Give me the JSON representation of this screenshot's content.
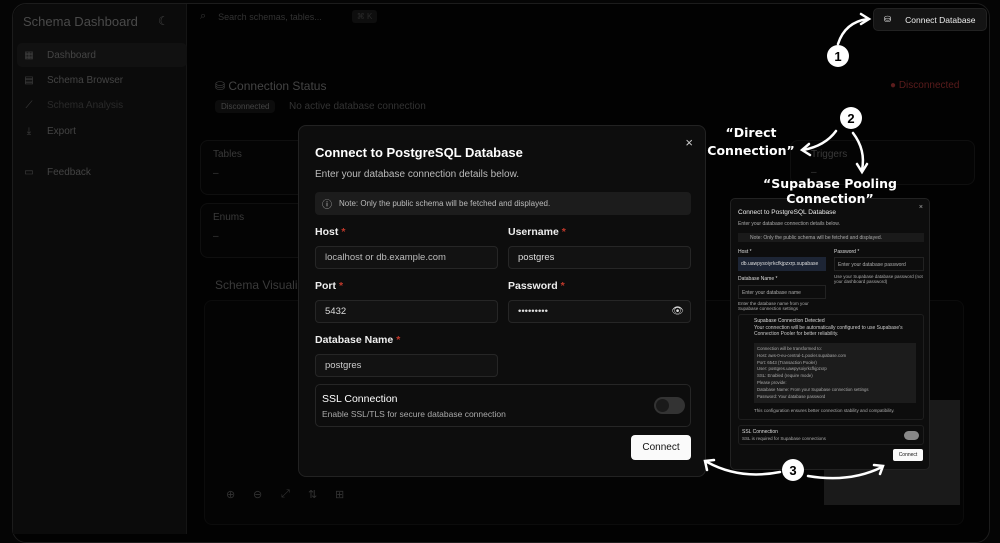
{
  "sidebar": {
    "title": "Schema Dashboard",
    "items": [
      {
        "label": "Dashboard",
        "icon": "grid-icon"
      },
      {
        "label": "Schema Browser",
        "icon": "file-icon"
      },
      {
        "label": "Schema Analysis",
        "icon": "chart-icon"
      },
      {
        "label": "Export",
        "icon": "download-icon"
      },
      {
        "label": "Feedback",
        "icon": "message-icon"
      }
    ]
  },
  "header": {
    "search_placeholder": "Search schemas, tables...",
    "shortcut": "⌘ K",
    "connect_label": "Connect Database"
  },
  "status": {
    "title": "Connection Status",
    "badge": "Disconnected",
    "message": "No active database connection",
    "indicator": "Disconnected",
    "indicator_color": "#7a1f1f"
  },
  "cards": {
    "tables": "Tables",
    "tables_value": "–",
    "enums": "Enums",
    "enums_value": "–",
    "triggers": "Triggers",
    "triggers_value": "–",
    "schema_vis": "Schema Visualization"
  },
  "modal": {
    "title": "Connect to PostgreSQL Database",
    "subtitle": "Enter your database connection details below.",
    "note": "Note: Only the public schema will be fetched and displayed.",
    "host_label": "Host",
    "host_placeholder": "localhost or db.example.com",
    "username_label": "Username",
    "username_value": "postgres",
    "port_label": "Port",
    "port_value": "5432",
    "password_label": "Password",
    "password_value": "•••••••••",
    "dbname_label": "Database Name",
    "dbname_value": "postgres",
    "ssl_title": "SSL Connection",
    "ssl_desc": "Enable SSL/TLS for secure database connection",
    "ssl_enabled": false,
    "connect_label": "Connect",
    "close": "×"
  },
  "inset": {
    "title": "Connect to PostgreSQL Database",
    "subtitle": "Enter your database connection details below.",
    "note": "Note: Only the public schema will be fetched and displayed.",
    "host_label": "Host *",
    "host_value": "db.uawpysoiyrkcfkjpzxrp.supabase",
    "password_label": "Password *",
    "password_placeholder": "Enter your database password",
    "password_hint": "Use your Supabase database password (not your dashboard password)",
    "dbname_label": "Database Name *",
    "dbname_placeholder": "Enter your database name",
    "dbname_hint": "Enter the database name from your Supabase connection settings",
    "detected_title": "Supabase Connection Detected",
    "detected_desc": "Your connection will be automatically configured to use Supabase's Connection Pooler for better reliability.",
    "transform_title": "Connection will be transformed to:",
    "transform": [
      "Host: aws-0-eu-central-1.pooler.supabase.com",
      "Port: 6543 (Transaction Pooler)",
      "User: postgres.uawpysoiyrkcfkjpzxrp",
      "SSL: Enabled (require mode)"
    ],
    "provide_title": "Please provide:",
    "provide": [
      "Database Name: From your Supabase connection settings",
      "Password: Your database password"
    ],
    "footer": "This configuration ensures better connection stability and compatibility.",
    "ssl_title": "SSL Connection",
    "ssl_desc": "SSL is required for Supabase connections",
    "ssl_enabled": true,
    "connect_label": "Connect",
    "close": "×"
  },
  "annotations": {
    "step1": "1",
    "step2": "2",
    "step3": "3",
    "direct": "“Direct Connection”",
    "pooling": "“Supabase Pooling Connection”"
  },
  "toolbar": {
    "icons": [
      "zoom-in-icon",
      "zoom-out-icon",
      "expand-icon",
      "sort-icon",
      "grid-icon"
    ]
  }
}
